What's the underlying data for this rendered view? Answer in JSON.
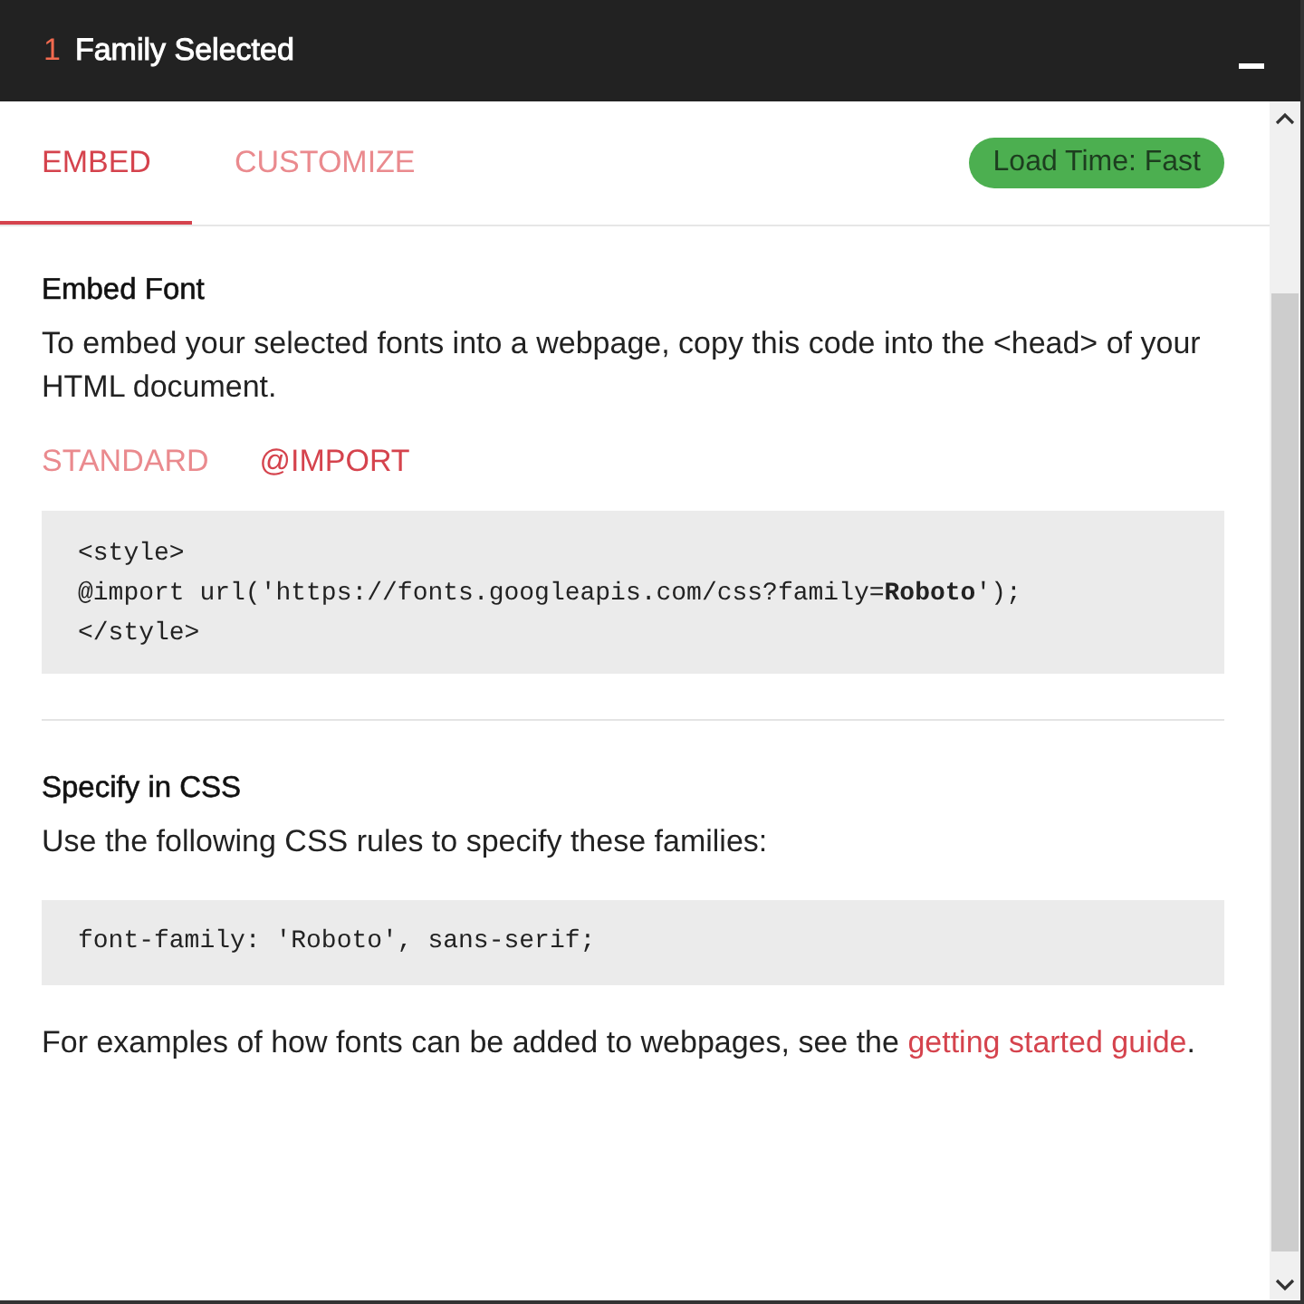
{
  "header": {
    "count": "1",
    "title": "Family Selected"
  },
  "tabs": [
    {
      "label": "EMBED",
      "selected": true
    },
    {
      "label": "CUSTOMIZE",
      "selected": false
    }
  ],
  "load_time_badge": "Load Time: Fast",
  "embed_section": {
    "heading": "Embed Font",
    "description": "To embed your selected fonts into a webpage, copy this code into the <head> of your HTML document.",
    "subtabs": [
      {
        "label": "STANDARD",
        "selected": false
      },
      {
        "label": "@IMPORT",
        "selected": true
      }
    ],
    "code_lines": [
      "<style>",
      "@import url('https://fonts.googleapis.com/css?family=**Roboto**');",
      "</style>"
    ]
  },
  "css_section": {
    "heading": "Specify in CSS",
    "description": "Use the following CSS rules to specify these families:",
    "code_lines": [
      "font-family: 'Roboto', sans-serif;"
    ]
  },
  "footer_note": {
    "text": "For examples of how fonts can be added to webpages, see the",
    "link": "getting started guide",
    "after": "."
  }
}
